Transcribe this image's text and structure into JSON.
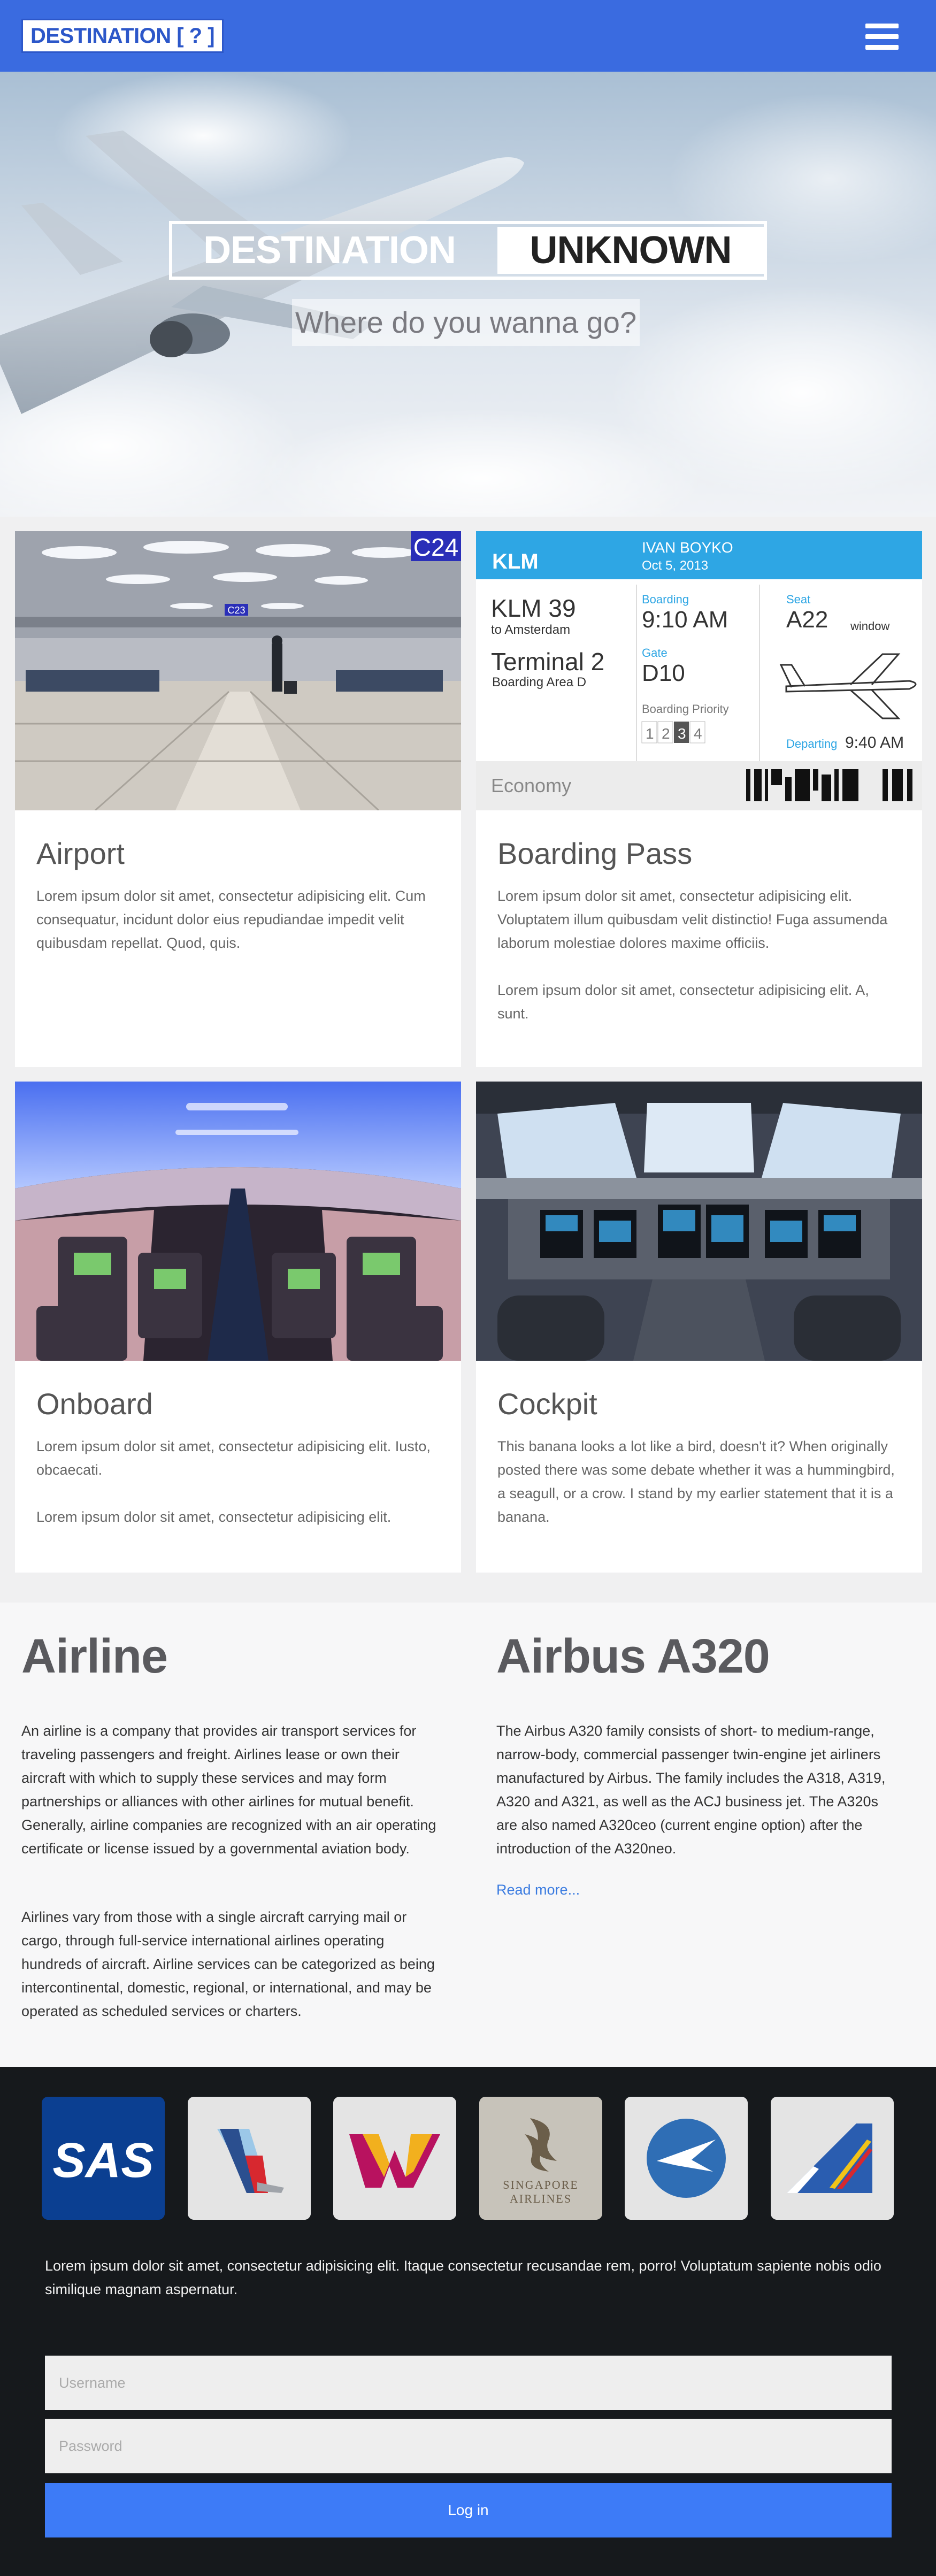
{
  "header": {
    "logo": "DESTINATION [ ? ]",
    "menu_icon": "hamburger-icon",
    "bg_color": "#3a6be0"
  },
  "hero": {
    "title_left": "DESTINATION",
    "title_right": "UNKNOWN",
    "subtitle": "Where do you wanna go?"
  },
  "cards": [
    {
      "title": "Airport",
      "paragraphs": [
        "Lorem ipsum dolor sit amet, consectetur adipisicing elit. Cum consequatur, incidunt dolor eius repudiandae impedit velit quibusdam repellat. Quod, quis."
      ],
      "image": {
        "gate_sign_big": "C24",
        "gate_sign_small": "C23"
      }
    },
    {
      "title": "Boarding Pass",
      "paragraphs": [
        "Lorem ipsum dolor sit amet, consectetur adipisicing elit. Voluptatem illum quibusdam velit distinctio! Fuga assumenda laborum molestiae dolores maxime officiis.",
        "Lorem ipsum dolor sit amet, consectetur adipisicing elit. A, sunt."
      ],
      "image": {
        "airline": "KLM",
        "passenger": "IVAN BOYKO",
        "date": "Oct 5, 2013",
        "flight": "KLM 39",
        "destination": "to Amsterdam",
        "terminal": "Terminal 2",
        "area": "Boarding Area D",
        "boarding_label": "Boarding",
        "boarding_time": "9:10 AM",
        "gate_label": "Gate",
        "gate": "D10",
        "priority_label": "Boarding Priority",
        "priority": [
          "1",
          "2",
          "3",
          "4"
        ],
        "seat_label": "Seat",
        "seat": "A22",
        "seat_type": "window",
        "departing_label": "Departing",
        "departing_time": "9:40 AM",
        "class": "Economy"
      }
    },
    {
      "title": "Onboard",
      "paragraphs": [
        "Lorem ipsum dolor sit amet, consectetur adipisicing elit. Iusto, obcaecati.",
        "Lorem ipsum dolor sit amet, consectetur adipisicing elit."
      ]
    },
    {
      "title": "Cockpit",
      "paragraphs": [
        "This banana looks a lot like a bird, doesn't it? When originally posted there was some debate whether it was a hummingbird, a seagull, or a crow. I stand by my earlier statement that it is a banana."
      ]
    }
  ],
  "info": {
    "airline": {
      "heading": "Airline",
      "paragraphs": [
        "An airline is a company that provides air transport services for traveling passengers and freight. Airlines lease or own their aircraft with which to supply these services and may form partnerships or alliances with other airlines for mutual benefit. Generally, airline companies are recognized with an air operating certificate or license issued by a governmental aviation body.",
        "Airlines vary from those with a single aircraft carrying mail or cargo, through full-service international airlines operating hundreds of aircraft. Airline services can be categorized as being intercontinental, domestic, regional, or international, and may be operated as scheduled services or charters."
      ]
    },
    "airbus": {
      "heading": "Airbus A320",
      "paragraph": "The Airbus A320 family consists of short- to medium-range, narrow-body, commercial passenger twin-engine jet airliners manufactured by Airbus. The family includes the A318, A319, A320 and A321, as well as the ACJ business jet. The A320s are also named A320ceo (current engine option) after the introduction of the A320neo.",
      "link": "Read more..."
    }
  },
  "footer": {
    "brands": [
      {
        "name": "sas-logo",
        "text": "SAS"
      },
      {
        "name": "american-airlines-logo",
        "text": ""
      },
      {
        "name": "germanwings-logo",
        "text": ""
      },
      {
        "name": "singapore-airlines-logo",
        "text": "SINGAPORE AIRLINES"
      },
      {
        "name": "bird-logo",
        "text": ""
      },
      {
        "name": "airline-tail-logo",
        "text": ""
      }
    ],
    "text": "Lorem ipsum dolor sit amet, consectetur adipisicing elit. Itaque consectetur recusandae rem, porro! Voluptatum sapiente nobis odio similique magnam aspernatur.",
    "username_placeholder": "Username",
    "password_placeholder": "Password",
    "login_label": "Log in",
    "button_color": "#3d7bf7"
  }
}
